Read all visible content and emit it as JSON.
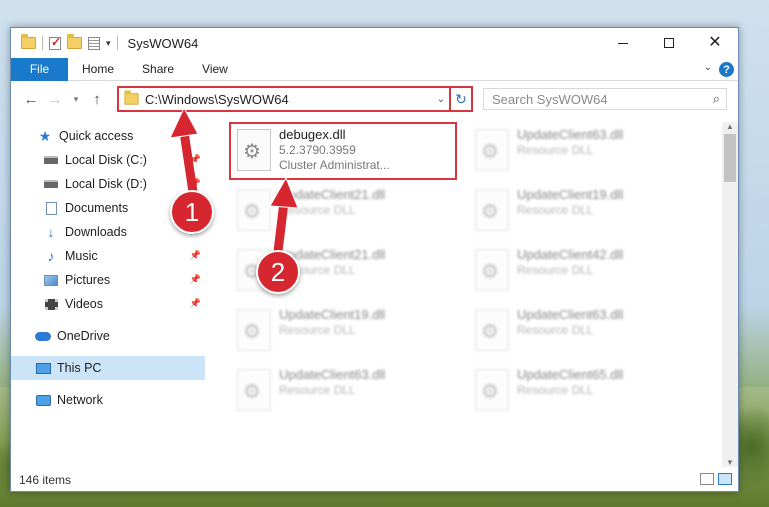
{
  "window": {
    "title": "SysWOW64"
  },
  "ribbon": {
    "tabs": [
      "File",
      "Home",
      "Share",
      "View"
    ],
    "help": "?"
  },
  "address": {
    "path": "C:\\Windows\\SysWOW64",
    "search_placeholder": "Search SysWOW64"
  },
  "sidebar": {
    "items": [
      {
        "label": "Quick access",
        "icon": "star-icon"
      },
      {
        "label": "Local Disk (C:)",
        "icon": "drive-icon"
      },
      {
        "label": "Local Disk (D:)",
        "icon": "drive-icon"
      },
      {
        "label": "Documents",
        "icon": "documents-icon"
      },
      {
        "label": "Downloads",
        "icon": "downloads-icon"
      },
      {
        "label": "Music",
        "icon": "music-icon"
      },
      {
        "label": "Pictures",
        "icon": "pictures-icon"
      },
      {
        "label": "Videos",
        "icon": "videos-icon"
      },
      {
        "label": "OneDrive",
        "icon": "onedrive-icon"
      },
      {
        "label": "This PC",
        "icon": "this-pc-icon"
      },
      {
        "label": "Network",
        "icon": "network-icon"
      }
    ]
  },
  "files": [
    {
      "name": "debugex.dll",
      "line2": "5.2.3790.3959",
      "line3": "Cluster Administrat..."
    },
    {
      "name": "UpdateClient63.dll",
      "line2": "Resource DLL"
    },
    {
      "name": "UpdateClient21.dll",
      "line2": "Resource DLL"
    },
    {
      "name": "UpdateClient19.dll",
      "line2": "Resource DLL"
    },
    {
      "name": "UpdateClient21.dll",
      "line2": "Resource DLL"
    },
    {
      "name": "UpdateClient42.dll",
      "line2": "Resource DLL"
    },
    {
      "name": "UpdateClient19.dll",
      "line2": "Resource DLL"
    },
    {
      "name": "UpdateClient63.dll",
      "line2": "Resource DLL"
    },
    {
      "name": "UpdateClient63.dll",
      "line2": "Resource DLL"
    },
    {
      "name": "UpdateClient65.dll",
      "line2": "Resource DLL"
    }
  ],
  "status": {
    "count": "146 items"
  },
  "annotations": {
    "badge1": "1",
    "badge2": "2",
    "color": "#d6262f"
  }
}
